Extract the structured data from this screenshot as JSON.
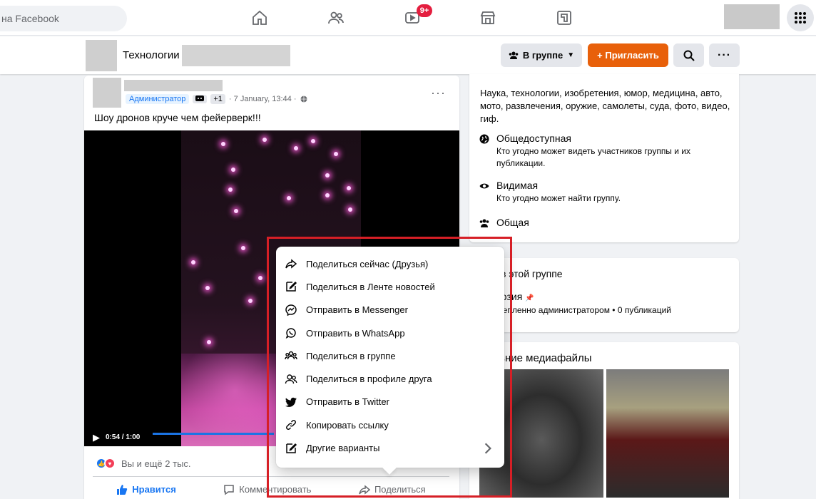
{
  "topnav": {
    "search_text": "на Facebook",
    "notif_badge": "9+"
  },
  "group": {
    "name": "Технологии",
    "in_group_label": "В группе",
    "invite_label": "+ Пригласить"
  },
  "post": {
    "role_badge": "Администратор",
    "extra_count": "+1",
    "timestamp": "· 7 January, 13:44 ·",
    "text": "Шоу дронов круче чем фейерверк!!!",
    "video_time": "0:54 / 1:00",
    "reactions_text": "Вы и ещё 2 тыс.",
    "actions": {
      "like": "Нравится",
      "comment": "Комментировать",
      "share": "Поделиться"
    }
  },
  "about": {
    "description": "Наука, технологии, изобретения, юмор, медицина, авто, мото, развлечения, оружие, самолеты, суда, фото, видео, гиф.",
    "public_title": "Общедоступная",
    "public_sub": "Кто угодно может видеть участников группы и их публикации.",
    "visible_title": "Видимая",
    "visible_sub": "Кто угодно может найти группу.",
    "general_title": "Общая"
  },
  "featured": {
    "title": "в этой группе",
    "item_title": "юзия",
    "item_sub": "репленно администратором • 0 публикаций"
  },
  "media": {
    "title": "вние медиафайлы"
  },
  "share_menu": {
    "items": [
      "Поделиться сейчас (Друзья)",
      "Поделиться в Ленте новостей",
      "Отправить в Messenger",
      "Отправить в WhatsApp",
      "Поделиться в группе",
      "Поделиться в профиле друга",
      "Отправить в Twitter",
      "Копировать ссылку",
      "Другие варианты"
    ]
  },
  "colors": {
    "accent_blue": "#1876f2",
    "orange": "#e8600a",
    "highlight_red": "#d61f26"
  }
}
